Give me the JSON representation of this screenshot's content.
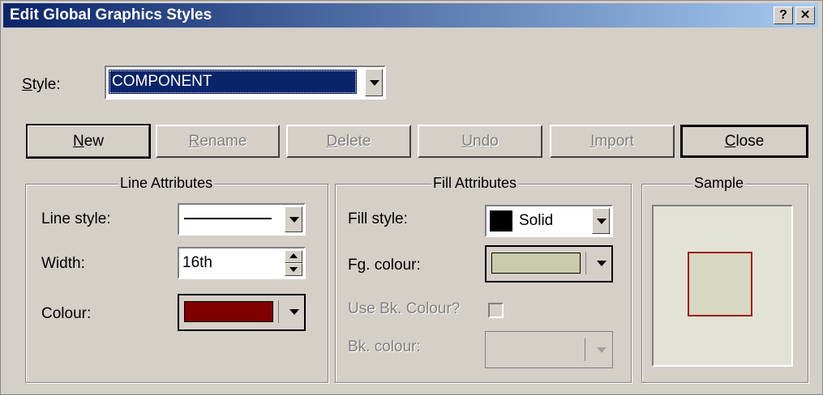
{
  "window": {
    "title": "Edit Global Graphics Styles",
    "help_label": "?",
    "close_label": "✕"
  },
  "style": {
    "label_accel": "S",
    "label_rest": "tyle:",
    "value": "COMPONENT"
  },
  "buttons": {
    "new_accel": "N",
    "new_rest": "ew",
    "rename_accel": "R",
    "rename_rest": "ename",
    "delete_accel": "D",
    "delete_rest": "elete",
    "undo_accel": "U",
    "undo_rest": "ndo",
    "import_accel": "I",
    "import_rest": "mport",
    "close_accel": "C",
    "close_rest": "lose"
  },
  "line_attributes": {
    "title": "Line Attributes",
    "line_style_label": "Line style:",
    "width_label": "Width:",
    "width_value": "16th",
    "colour_label": "Colour:",
    "colour_value": "#800000"
  },
  "fill_attributes": {
    "title": "Fill Attributes",
    "fill_style_label": "Fill style:",
    "fill_style_value": "Solid",
    "fg_colour_label": "Fg. colour:",
    "fg_colour_value": "#c8ccaa",
    "use_bk_label": "Use Bk. Colour?",
    "use_bk_checked": false,
    "bk_colour_label": "Bk. colour:"
  },
  "sample": {
    "title": "Sample",
    "fill": "#d8d8c0",
    "stroke": "#9b1b1b"
  }
}
